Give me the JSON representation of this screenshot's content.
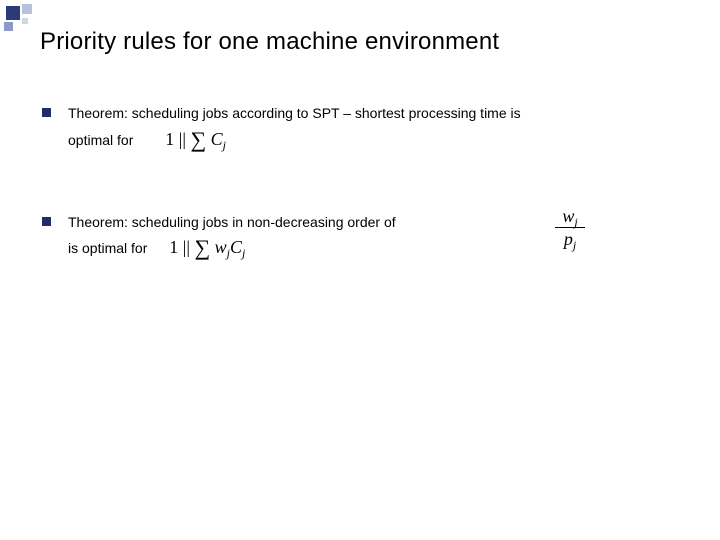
{
  "title": "Priority rules for one machine environment",
  "bullets": [
    {
      "text_a": "Theorem: scheduling jobs according to SPT – shortest processing time is",
      "text_b": "optimal for",
      "formula": {
        "prefix": "1 ||",
        "sum": "∑",
        "term": "C",
        "sub": "j"
      }
    },
    {
      "text_a": "Theorem: scheduling jobs in non-decreasing order of",
      "text_b": " is optimal for",
      "ratio": {
        "num_var": "w",
        "num_sub": "j",
        "den_var": "p",
        "den_sub": "j"
      },
      "formula": {
        "prefix": "1 ||",
        "sum": "∑",
        "w": "w",
        "wsub": "j",
        "term": "C",
        "sub": "j"
      }
    }
  ]
}
